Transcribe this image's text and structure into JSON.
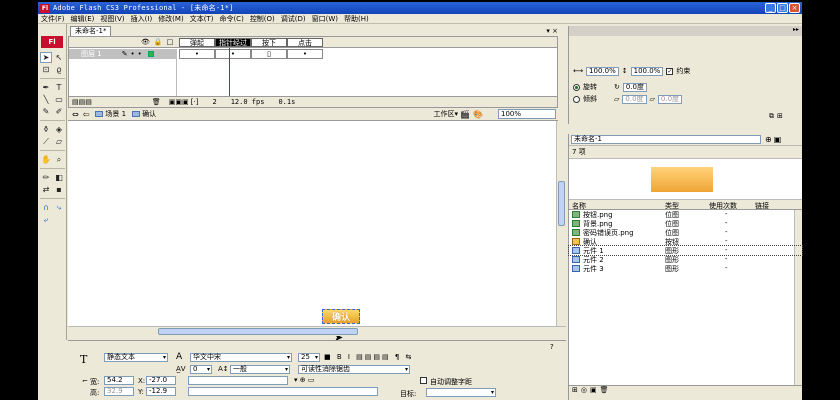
{
  "window": {
    "title": "Adobe Flash CS3 Professional - [未命名-1*]",
    "app_icon": "Fl"
  },
  "menu": [
    "文件(F)",
    "编辑(E)",
    "视图(V)",
    "插入(I)",
    "修改(M)",
    "文本(T)",
    "命令(C)",
    "控制(O)",
    "调试(D)",
    "窗口(W)",
    "帮助(H)"
  ],
  "tools_logo": "Fl",
  "document_tab": "未命名-1*",
  "timeline": {
    "frame_labels": [
      "弹起",
      "指针经过",
      "按下",
      "点击"
    ],
    "current_frame_index": 1,
    "layer_name": "图层 1",
    "frame_marks": [
      "•",
      "•",
      "▯",
      "•"
    ],
    "status_frame": "2",
    "status_fps": "12.0 fps",
    "status_time": "0.1s"
  },
  "editbar": {
    "scene": "场景 1",
    "symbol": "确认",
    "workspace": "工作区▾",
    "zoom": "100%"
  },
  "stage": {
    "button_text": "确认"
  },
  "transform": {
    "width_pct": "100.0%",
    "height_pct": "100.0%",
    "constrain": "约束",
    "rotate_label": "旋转",
    "rotate_value": "0.0度",
    "skew_label": "倾斜",
    "skew_value1": "0.0度",
    "skew_value2": "0.0度"
  },
  "library": {
    "doc": "未命名-1",
    "count": "7 项",
    "columns": [
      "名称",
      "类型",
      "使用次数",
      "链接"
    ],
    "items": [
      {
        "name": "按钮.png",
        "type": "位图",
        "uses": "-",
        "icon": "bitmap-icon"
      },
      {
        "name": "背景.png",
        "type": "位图",
        "uses": "-",
        "icon": "bitmap-icon"
      },
      {
        "name": "密码错误页.png",
        "type": "位图",
        "uses": "-",
        "icon": "bitmap-icon"
      },
      {
        "name": "确认",
        "type": "按钮",
        "uses": "-",
        "icon": "button-icon"
      },
      {
        "name": "元件 1",
        "type": "图形",
        "uses": "-",
        "icon": "graphic-icon"
      },
      {
        "name": "元件 2",
        "type": "图形",
        "uses": "-",
        "icon": "graphic-icon"
      },
      {
        "name": "元件 3",
        "type": "图形",
        "uses": "-",
        "icon": "graphic-icon"
      }
    ],
    "selected_index": 4
  },
  "properties": {
    "text_type": "静态文本",
    "font": "华文中宋",
    "font_size": "25",
    "letter_spacing": "0",
    "rendering": "一般",
    "anti_alias": "可读性消除锯齿",
    "width_label": "宽:",
    "width": "54.2",
    "x_label": "X:",
    "x": "-27.0",
    "height_label": "高:",
    "height": "32.9",
    "y_label": "Y:",
    "y": "-12.9",
    "auto_kern": "自动调整字距",
    "target_label": "目标:"
  }
}
